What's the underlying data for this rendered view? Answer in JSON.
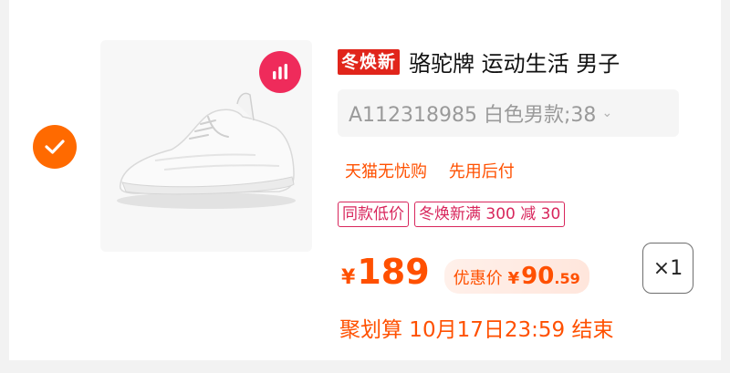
{
  "item": {
    "promo_tag": "冬焕新",
    "title": "骆驼牌 运动生活 男子",
    "sku": "A112318985 白色男款;38",
    "services": [
      "天猫无忧购",
      "先用后付"
    ],
    "tags": [
      "同款低价",
      "冬焕新满 300 减 30"
    ],
    "price": {
      "currency": "¥",
      "amount": "189"
    },
    "discount": {
      "label": "优惠价",
      "currency": "¥",
      "integer": "90",
      "decimal": ".59"
    },
    "quantity": "×1",
    "deadline": "聚划算 10月17日23:59 结束",
    "selected": true
  },
  "colors": {
    "accent": "#ff6a00",
    "promo": "#e1251b",
    "tag": "#d8265c",
    "badge": "#ef2b5b"
  }
}
